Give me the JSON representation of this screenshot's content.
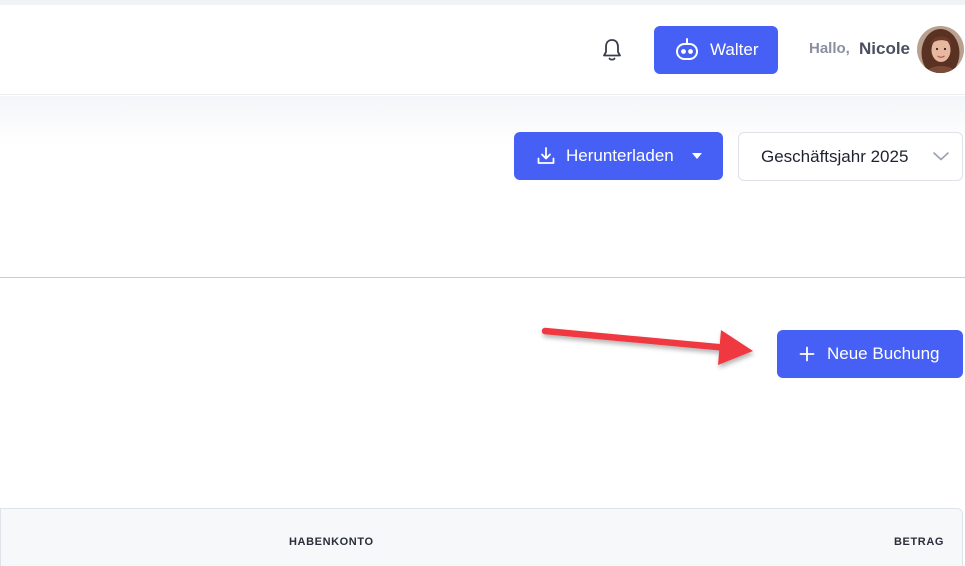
{
  "header": {
    "assistant_button_label": "Walter",
    "greeting": "Hallo,",
    "user_name": "Nicole"
  },
  "toolbar": {
    "download_label": "Herunterladen",
    "fiscal_year_selected": "Geschäftsjahr 2025"
  },
  "actions": {
    "new_booking_label": "Neue Buchung"
  },
  "table": {
    "columns": [
      "HABENKONTO",
      "BETRAG"
    ]
  },
  "icons": {
    "bell": "bell-icon",
    "robot": "robot-icon",
    "download": "download-icon",
    "chevron": "chevron-down-icon",
    "plus": "plus-icon"
  },
  "colors": {
    "primary": "#4660f5",
    "annotation_arrow": "#f0383f"
  }
}
